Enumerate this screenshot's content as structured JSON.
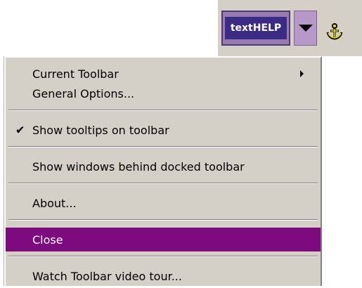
{
  "toolbar": {
    "logo_text": "textHELP",
    "dropdown_icon": "chevron-down-icon",
    "anchor_icon": "anchor-icon",
    "accent": "#3b2b84"
  },
  "menu": {
    "items": [
      {
        "label": "Current Toolbar",
        "has_submenu": true
      },
      {
        "label": "General Options..."
      },
      {
        "label": "Show tooltips on toolbar",
        "checked": true
      },
      {
        "label": "Show windows behind docked toolbar"
      },
      {
        "label": "About..."
      },
      {
        "label": "Close",
        "selected": true
      },
      {
        "label": "Watch Toolbar video tour..."
      }
    ],
    "highlight_color": "#7d0a7e"
  }
}
